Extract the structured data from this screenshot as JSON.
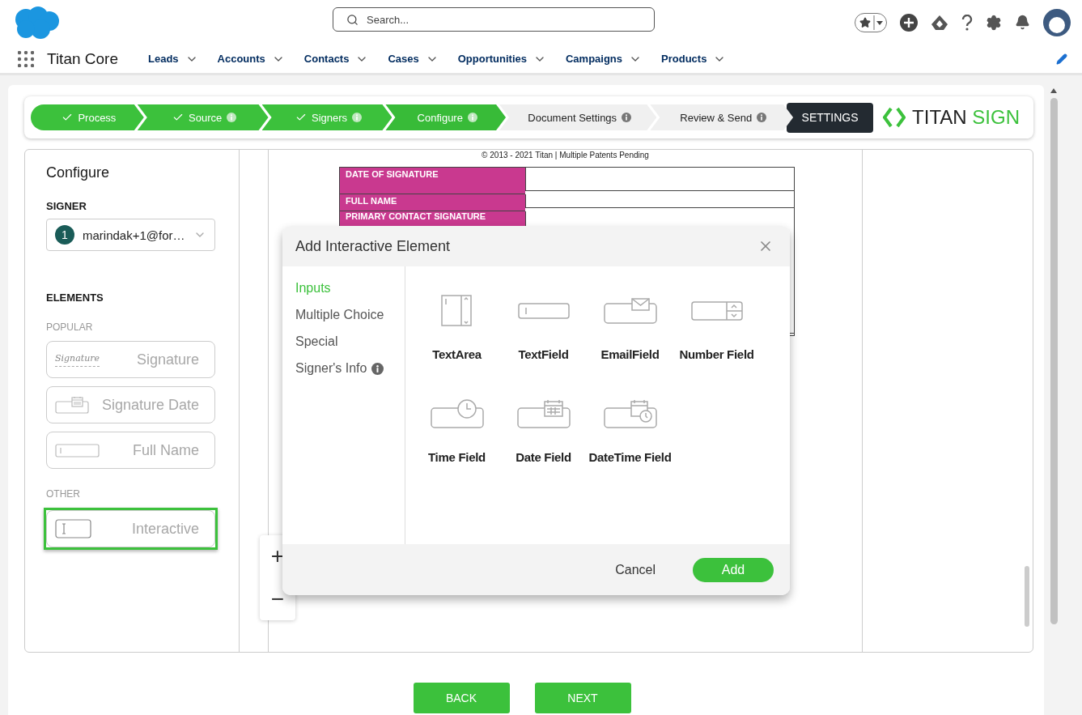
{
  "header": {
    "search": {
      "placeholder": "Search..."
    }
  },
  "nav": {
    "app_name": "Titan Core",
    "items": [
      {
        "label": "Leads"
      },
      {
        "label": "Accounts"
      },
      {
        "label": "Contacts"
      },
      {
        "label": "Cases"
      },
      {
        "label": "Opportunities"
      },
      {
        "label": "Campaigns"
      },
      {
        "label": "Products"
      }
    ]
  },
  "steps": [
    {
      "label": "Process",
      "done": true,
      "selected": false,
      "info": false
    },
    {
      "label": "Source",
      "done": true,
      "selected": false,
      "info": true
    },
    {
      "label": "Signers",
      "done": true,
      "selected": false,
      "info": true
    },
    {
      "label": "Configure",
      "done": false,
      "selected": true,
      "info": true
    },
    {
      "label": "Document Settings",
      "done": false,
      "selected": false,
      "info": true
    },
    {
      "label": "Review & Send",
      "done": false,
      "selected": false,
      "info": true
    }
  ],
  "settings_button": "SETTINGS",
  "brand": {
    "name": "TITAN",
    "accent": "SIGN"
  },
  "sidebar": {
    "title": "Configure",
    "signer_label": "SIGNER",
    "signer": {
      "number": "1",
      "email": "marindak+1@for…"
    },
    "elements_label": "ELEMENTS",
    "groups": [
      {
        "label": "POPULAR",
        "items": [
          {
            "label": "Signature",
            "kind": "signature",
            "sample": "Signature",
            "selected": false
          },
          {
            "label": "Signature Date",
            "kind": "date",
            "selected": false
          },
          {
            "label": "Full Name",
            "kind": "text",
            "selected": false
          }
        ]
      },
      {
        "label": "OTHER",
        "items": [
          {
            "label": "Interactive",
            "kind": "interactive",
            "selected": true
          }
        ]
      }
    ]
  },
  "document": {
    "footer_text": "© 2013 - 2021 Titan | Multiple Patents Pending",
    "table_rows": [
      "DATE OF SIGNATURE",
      "FULL NAME",
      "PRIMARY CONTACT SIGNATURE"
    ]
  },
  "zoom_controls": [
    "+",
    "−"
  ],
  "modal": {
    "title": "Add Interactive Element",
    "categories": [
      {
        "label": "Inputs",
        "selected": true,
        "info": false
      },
      {
        "label": "Multiple Choice",
        "selected": false,
        "info": false
      },
      {
        "label": "Special",
        "selected": false,
        "info": false
      },
      {
        "label": "Signer's Info",
        "selected": false,
        "info": true
      }
    ],
    "elements": [
      {
        "label": "TextArea",
        "kind": "textarea"
      },
      {
        "label": "TextField",
        "kind": "textfield"
      },
      {
        "label": "EmailField",
        "kind": "email"
      },
      {
        "label": "Number Field",
        "kind": "number"
      },
      {
        "label": "Time Field",
        "kind": "time"
      },
      {
        "label": "Date Field",
        "kind": "datefield"
      },
      {
        "label": "DateTime Field",
        "kind": "datetime"
      }
    ],
    "cancel": "Cancel",
    "add": "Add"
  },
  "footer_buttons": [
    "BACK",
    "NEXT"
  ]
}
